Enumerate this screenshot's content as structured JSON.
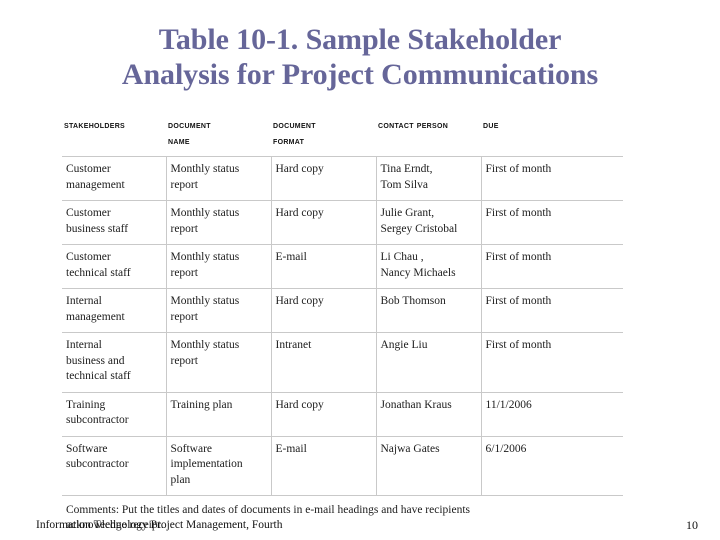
{
  "slide": {
    "title_lines": [
      "Table 10-1. Sample Stakeholder",
      "Analysis for Project Communications"
    ],
    "title_color": "#666699"
  },
  "table": {
    "headers": [
      {
        "lines": [
          "Stakeholders"
        ]
      },
      {
        "lines": [
          "Document",
          "Name"
        ]
      },
      {
        "lines": [
          "Document",
          "Format"
        ]
      },
      {
        "lines": [
          "Contact Person"
        ]
      },
      {
        "lines": [
          "Due"
        ]
      }
    ],
    "rows": [
      {
        "stakeholders": [
          "Customer",
          "management"
        ],
        "document_name": [
          "Monthly status",
          "report"
        ],
        "document_format": [
          "Hard copy"
        ],
        "contact_person": [
          "Tina Erndt,",
          "Tom Silva"
        ],
        "due": [
          "First of month"
        ]
      },
      {
        "stakeholders": [
          "Customer",
          "business staff"
        ],
        "document_name": [
          "Monthly status",
          "report"
        ],
        "document_format": [
          "Hard copy"
        ],
        "contact_person": [
          "Julie Grant,",
          "Sergey Cristobal"
        ],
        "due": [
          "First of month"
        ]
      },
      {
        "stakeholders": [
          "Customer",
          "technical staff"
        ],
        "document_name": [
          "Monthly status",
          "report"
        ],
        "document_format": [
          "E-mail"
        ],
        "contact_person": [
          "Li Chau ,",
          "Nancy Michaels"
        ],
        "due": [
          "First of month"
        ]
      },
      {
        "stakeholders": [
          "Internal",
          "management"
        ],
        "document_name": [
          "Monthly status",
          "report"
        ],
        "document_format": [
          "Hard copy"
        ],
        "contact_person": [
          "Bob Thomson"
        ],
        "due": [
          "First of month"
        ]
      },
      {
        "stakeholders": [
          "Internal",
          "business and",
          "technical staff"
        ],
        "document_name": [
          "Monthly status",
          "report"
        ],
        "document_format": [
          "Intranet"
        ],
        "contact_person": [
          "Angie Liu"
        ],
        "due": [
          "First of month"
        ]
      },
      {
        "stakeholders": [
          "Training",
          "subcontractor"
        ],
        "document_name": [
          "Training plan"
        ],
        "document_format": [
          "Hard copy"
        ],
        "contact_person": [
          "Jonathan Kraus"
        ],
        "due": [
          "11/1/2006"
        ]
      },
      {
        "stakeholders": [
          "Software",
          "subcontractor"
        ],
        "document_name": [
          "Software",
          "implementation",
          "plan"
        ],
        "document_format": [
          "E-mail"
        ],
        "contact_person": [
          "Najwa Gates"
        ],
        "due": [
          "6/1/2006"
        ]
      }
    ],
    "comments": [
      "Comments: Put the titles and dates of documents in e-mail headings and have recipients",
      "acknowledge receipt."
    ]
  },
  "footer": {
    "text": "Information Technology Project Management, Fourth",
    "page": "10"
  }
}
